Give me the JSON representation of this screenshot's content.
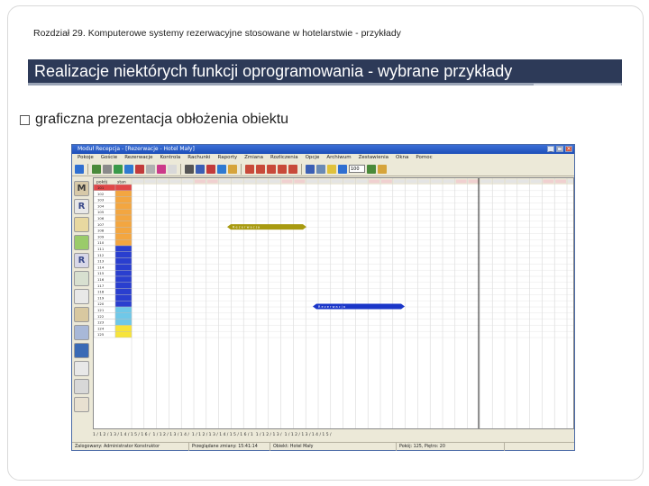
{
  "chapter": "Rozdział 29. Komputerowe systemy rezerwacyjne stosowane w hotelarstwie - przykłady",
  "title": "Realizacje niektórych funkcji oprogramowania - wybrane przykłady",
  "bullet": "graficzna prezentacja obłożenia obiektu",
  "app": {
    "window_title": "Moduł Recepcja - [Rezerwacje - Hotel Mały]",
    "menu": [
      "Pokoje",
      "Goście",
      "Rezerwacje",
      "Kontrola",
      "Rachunki",
      "Raporty",
      "Zmiana",
      "Rozliczenia",
      "Opcje",
      "Archiwum",
      "Zestawienia",
      "Okna",
      "Pomoc"
    ],
    "zoom_value": "100",
    "grid": {
      "header_col1": "pokój",
      "header_col2": "stan",
      "rooms": [
        "101",
        "102",
        "103",
        "104",
        "105",
        "106",
        "107",
        "108",
        "109",
        "110",
        "111",
        "112",
        "113",
        "114",
        "115",
        "116",
        "117",
        "118",
        "119",
        "120",
        "121",
        "122",
        "123",
        "124",
        "125"
      ],
      "reservation_1_label": "R e z e r w a c j a",
      "reservation_2_label": "R e z e r w a c j a"
    },
    "tabs": [
      "1 / 1 2 / 1 3 / 1 4 / 1 5 / 1 6 /",
      "1 / 1 2 / 1 3 / 1 4 /",
      "1 / 1 2 / 1 3 / 1 4 / 1 5 / 1 6 / 1",
      "1 / 1 2 / 1 3 /",
      "1 / 1 2 / 1 3 / 1 4 / 1 5 /"
    ],
    "status": {
      "operator": "Zalogowany: Administrator Konstruktor",
      "time": "Przeglądane zmiany: 15:41:14",
      "hotel": "Obiekt: Hotel Mały",
      "selection": "Pokój: 125, Piętro: 20"
    }
  }
}
